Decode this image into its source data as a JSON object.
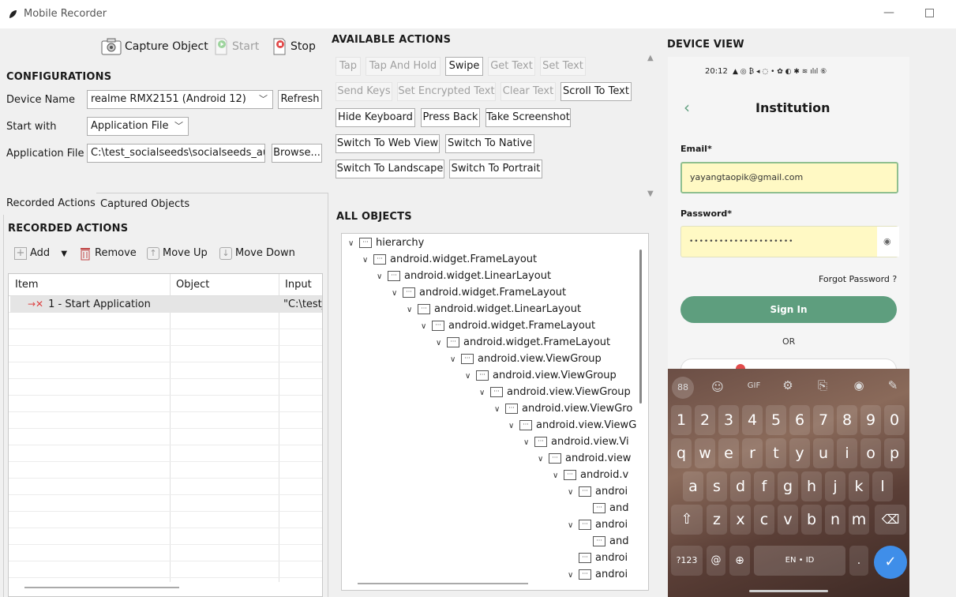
{
  "window": {
    "title": "Mobile Recorder",
    "minimize": "—"
  },
  "toolbar": {
    "capture": "Capture Object",
    "start": "Start",
    "stop": "Stop"
  },
  "config": {
    "heading": "CONFIGURATIONS",
    "device_name_label": "Device Name",
    "device_name_value": "realme RMX2151 (Android 12)",
    "refresh": "Refresh",
    "start_with_label": "Start with",
    "start_with_value": "Application File",
    "app_file_label": "Application File",
    "app_file_value": "C:\\test_socialseeds\\socialseeds_aut",
    "browse": "Browse..."
  },
  "tabs": {
    "recorded": "Recorded Actions",
    "captured": "Captured Objects"
  },
  "recorded": {
    "heading": "RECORDED ACTIONS",
    "add": "Add",
    "remove": "Remove",
    "move_up": "Move Up",
    "move_down": "Move Down",
    "columns": [
      "Item",
      "Object",
      "Input"
    ],
    "row1_item": "1 - Start Application",
    "row1_input": "\"C:\\test_"
  },
  "actions": {
    "heading": "AVAILABLE ACTIONS",
    "tap": "Tap",
    "tap_hold": "Tap And Hold",
    "swipe": "Swipe",
    "get_text": "Get Text",
    "set_text": "Set Text",
    "send_keys": "Send Keys",
    "set_enc": "Set Encrypted Text",
    "clear_text": "Clear Text",
    "scroll_text": "Scroll To Text",
    "hide_kb": "Hide Keyboard",
    "press_back": "Press Back",
    "screenshot": "Take Screenshot",
    "web_view": "Switch To Web View",
    "native": "Switch To Native",
    "landscape": "Switch To Landscape",
    "portrait": "Switch To Portrait"
  },
  "objects": {
    "heading": "ALL OBJECTS",
    "n0": "hierarchy",
    "n1": "android.widget.FrameLayout",
    "n2": "android.widget.LinearLayout",
    "n3": "android.widget.FrameLayout",
    "n4": "android.widget.LinearLayout",
    "n5": "android.widget.FrameLayout",
    "n6": "android.widget.FrameLayout",
    "n7": "android.view.ViewGroup",
    "n8": "android.view.ViewGroup",
    "n9": "android.view.ViewGroup",
    "n10": "android.view.ViewGro",
    "n11": "android.view.ViewG",
    "n12": "android.view.Vi",
    "n13": "android.view",
    "n14": "android.v",
    "n15": "androi",
    "n16": "and",
    "n17": "androi",
    "n18": "and",
    "n19": "androi",
    "n20": "androi"
  },
  "device": {
    "heading": "DEVICE VIEW",
    "time": "20:12",
    "status_icons": "▲ ◎ ₿ ◂ ◌ •   ✿ ◐ ✱ ≋ ılıl ⑥",
    "title": "Institution",
    "email_label": "Email*",
    "email_value": "yayangtaopik@gmail.com",
    "password_label": "Password*",
    "password_value": "•••••••••••••••••••••",
    "forgot": "Forgot Password ?",
    "sign_in": "Sign In",
    "or": "OR",
    "kb_top": [
      "88",
      "☺",
      "GIF",
      "⚙",
      "⎘",
      "◉",
      "✎"
    ],
    "kb_row1": [
      "1",
      "2",
      "3",
      "4",
      "5",
      "6",
      "7",
      "8",
      "9",
      "0"
    ],
    "kb_row2": [
      "q",
      "w",
      "e",
      "r",
      "t",
      "y",
      "u",
      "i",
      "o",
      "p"
    ],
    "kb_row3": [
      "a",
      "s",
      "d",
      "f",
      "g",
      "h",
      "j",
      "k",
      "l"
    ],
    "kb_row4": [
      "z",
      "x",
      "c",
      "v",
      "b",
      "n",
      "m"
    ],
    "kb_sym": "?123",
    "kb_at": "@",
    "kb_lang": "EN • ID",
    "kb_dot": "."
  },
  "colors": {
    "accent_green": "#5e9e7e",
    "field_yellow": "#fff9c4",
    "field_border": "#8fbf8f"
  }
}
